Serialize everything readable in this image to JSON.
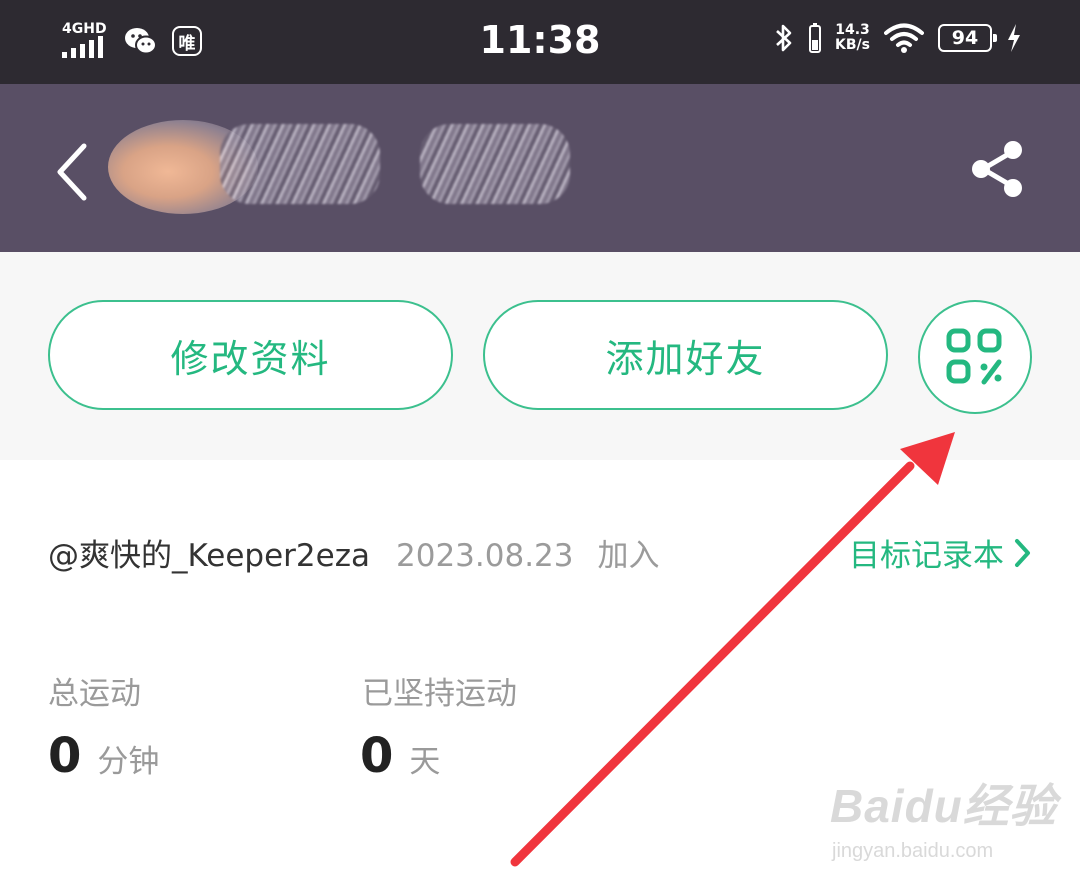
{
  "status_bar": {
    "network_label": "4GHD",
    "app_badge_text": "唯",
    "time": "11:38",
    "net_speed_value": "14.3",
    "net_speed_unit": "KB/s",
    "battery_level": "94"
  },
  "buttons": {
    "edit_profile": "修改资料",
    "add_friend": "添加好友"
  },
  "profile": {
    "username": "@爽快的_Keeper2eza",
    "join_date": "2023.08.23",
    "join_suffix": "加入",
    "goal_link": "目标记录本",
    "goal_chevron": "›"
  },
  "stats": {
    "total_label": "总运动",
    "total_value": "0",
    "total_unit": "分钟",
    "streak_label": "已坚持运动",
    "streak_value": "0",
    "streak_unit": "天"
  },
  "watermark": {
    "brand": "Baidu经验",
    "url": "jingyan.baidu.com"
  },
  "colors": {
    "accent_green": "#24b880",
    "header_bg": "#594f65",
    "status_bg": "#2d2a31",
    "annotation_arrow": "#f0353d"
  },
  "icons": [
    "back-arrow-icon",
    "share-icon",
    "qr-code-icon",
    "wechat-icon",
    "bluetooth-icon",
    "wifi-icon",
    "charging-icon"
  ]
}
